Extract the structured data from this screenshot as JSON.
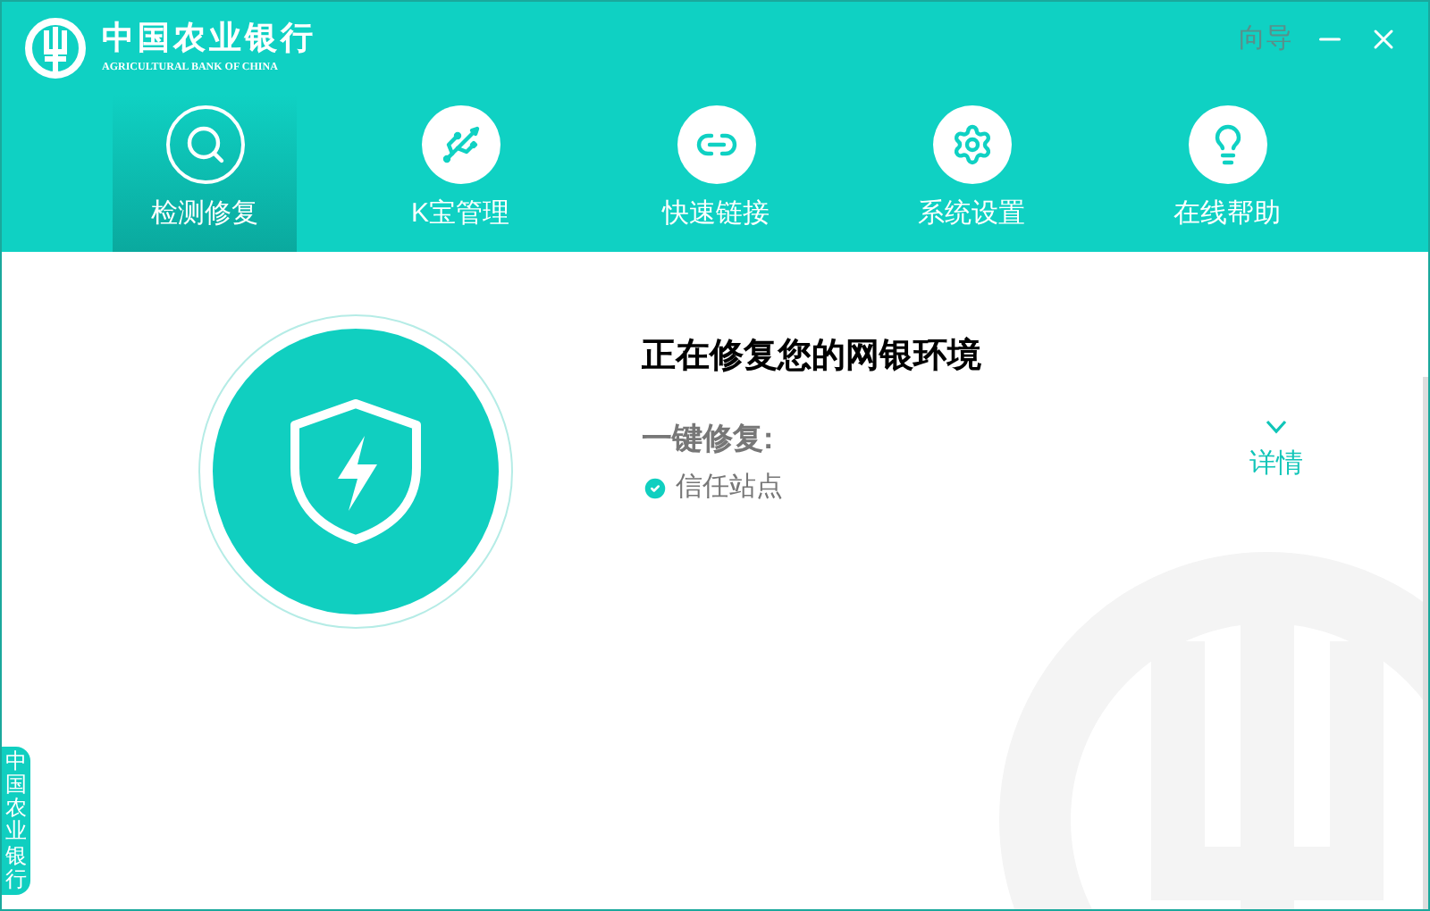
{
  "brand": {
    "name": "中国农业银行",
    "subtitle": "AGRICULTURAL BANK OF CHINA"
  },
  "window_controls": {
    "guide": "向导"
  },
  "tabs": [
    {
      "label": "检测修复",
      "kind": "scan",
      "selected": true
    },
    {
      "label": "K宝管理",
      "kind": "usb",
      "selected": false
    },
    {
      "label": "快速链接",
      "kind": "link",
      "selected": false
    },
    {
      "label": "系统设置",
      "kind": "gear",
      "selected": false
    },
    {
      "label": "在线帮助",
      "kind": "bulb",
      "selected": false
    }
  ],
  "status": {
    "title": "正在修复您的网银环境",
    "section": "一键修复:",
    "items": [
      {
        "label": "信任站点",
        "checked": true
      }
    ],
    "details": "详情",
    "expanded": false
  },
  "side_tab": "中国农业银行"
}
